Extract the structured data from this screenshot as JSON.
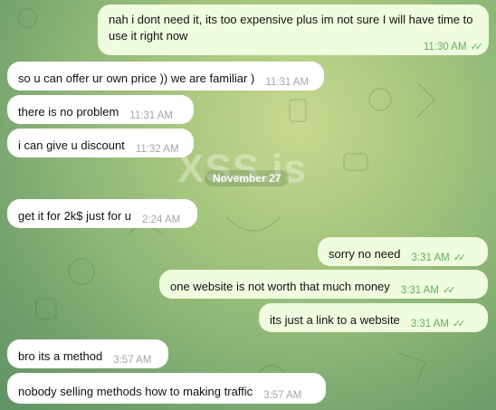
{
  "watermark": "XSS.is",
  "date_separator": "November 27",
  "messages": [
    {
      "dir": "out",
      "text": "nah i dont need it, its too expensive plus im not sure I will have time to use it right now",
      "time": "11:30 AM"
    },
    {
      "dir": "in",
      "text": "so u can offer ur own price )) we are familiar )",
      "time": "11:31 AM"
    },
    {
      "dir": "in",
      "text": "there is no problem",
      "time": "11:31 AM"
    },
    {
      "dir": "in",
      "text": "i can give u discount",
      "time": "11:32 AM"
    },
    {
      "dir": "in",
      "text": "get it for 2k$ just for u",
      "time": "2:24 AM"
    },
    {
      "dir": "out",
      "text": "sorry no need",
      "time": "3:31 AM"
    },
    {
      "dir": "out",
      "text": "one website is not worth that much money",
      "time": "3:31 AM"
    },
    {
      "dir": "out",
      "text": "its just a link to a website",
      "time": "3:31 AM"
    },
    {
      "dir": "in",
      "text": "bro its a method",
      "time": "3:57 AM"
    },
    {
      "dir": "in",
      "text": "nobody selling methods how to making traffic",
      "time": "3:57 AM"
    }
  ],
  "colors": {
    "outgoing": "#effdde",
    "incoming": "#ffffff",
    "read_tick": "#5fb35a"
  },
  "icons": {
    "read_status": "double-check-icon"
  }
}
